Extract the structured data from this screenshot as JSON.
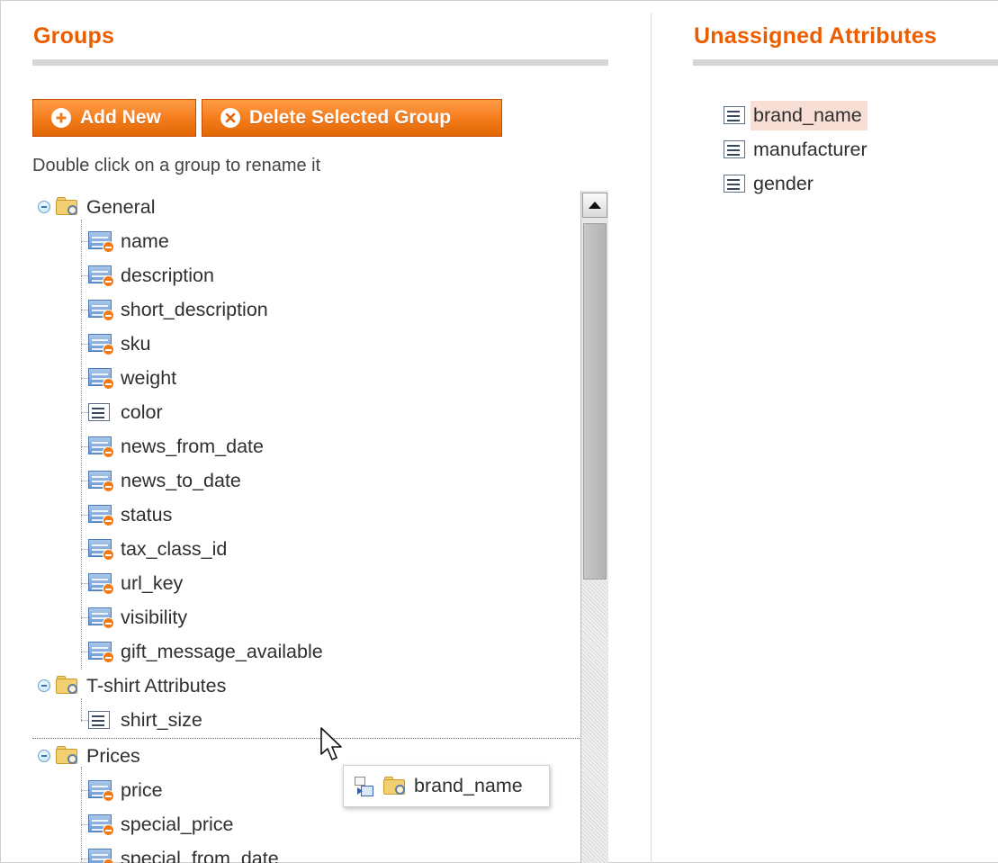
{
  "groups_panel": {
    "title": "Groups",
    "add_new_label": "Add New",
    "delete_group_label": "Delete Selected Group",
    "hint": "Double click on a group to rename it"
  },
  "tree": {
    "groups": [
      {
        "label": "General",
        "expanded": true,
        "items": [
          {
            "label": "name",
            "icon": "system-attribute-icon"
          },
          {
            "label": "description",
            "icon": "system-attribute-icon"
          },
          {
            "label": "short_description",
            "icon": "system-attribute-icon"
          },
          {
            "label": "sku",
            "icon": "system-attribute-icon"
          },
          {
            "label": "weight",
            "icon": "system-attribute-icon"
          },
          {
            "label": "color",
            "icon": "attribute-icon"
          },
          {
            "label": "news_from_date",
            "icon": "system-attribute-icon"
          },
          {
            "label": "news_to_date",
            "icon": "system-attribute-icon"
          },
          {
            "label": "status",
            "icon": "system-attribute-icon"
          },
          {
            "label": "tax_class_id",
            "icon": "system-attribute-icon"
          },
          {
            "label": "url_key",
            "icon": "system-attribute-icon"
          },
          {
            "label": "visibility",
            "icon": "system-attribute-icon"
          },
          {
            "label": "gift_message_available",
            "icon": "system-attribute-icon"
          }
        ]
      },
      {
        "label": "T-shirt Attributes",
        "expanded": true,
        "items": [
          {
            "label": "shirt_size",
            "icon": "attribute-icon"
          }
        ]
      },
      {
        "label": "Prices",
        "expanded": true,
        "items": [
          {
            "label": "price",
            "icon": "system-attribute-icon"
          },
          {
            "label": "special_price",
            "icon": "system-attribute-icon"
          },
          {
            "label": "special_from_date",
            "icon": "system-attribute-icon"
          }
        ]
      }
    ]
  },
  "drag": {
    "label": "brand_name"
  },
  "unassigned_panel": {
    "title": "Unassigned Attributes",
    "items": [
      {
        "label": "brand_name",
        "selected": true
      },
      {
        "label": "manufacturer",
        "selected": false
      },
      {
        "label": "gender",
        "selected": false
      }
    ]
  },
  "colors": {
    "accent": "#eb5e00",
    "button": "#f47b1a",
    "selection": "#f8dfd6"
  }
}
